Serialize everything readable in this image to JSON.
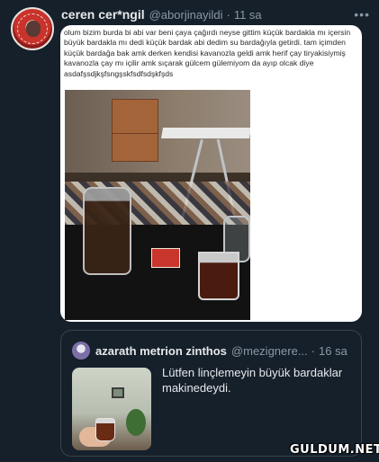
{
  "tweet": {
    "author_name": "ceren cer*ngil",
    "author_handle": "@aborjinayildi",
    "separator": "·",
    "time": "11 sa",
    "more_icon": "more-horizontal-icon",
    "image_text": "olum bizim burda bi abi var beni çaya çağırdı neyse gittim küçük bardakla mı içersin büyük bardakla mı dedi küçük bardak abi dedim su bardağıyla getirdi. tam içimden küçük bardağa bak amk derken kendisi kavanozla geldi amk herif çay tiryakisiymiş kavanozla çay mı içilir amk sıçarak gülcem gülemiyom da ayıp olcak diye asdafşsdjkşfsngşskfsdfsdşkfşds"
  },
  "quoted_tweet": {
    "author_name": "azarath metrion zinthos",
    "author_handle": "@mezignere...",
    "separator": "·",
    "time": "16 sa",
    "text": "Lütfen linçlemeyin büyük bardaklar makinedeydi."
  },
  "watermark": "GULDUM.NET"
}
